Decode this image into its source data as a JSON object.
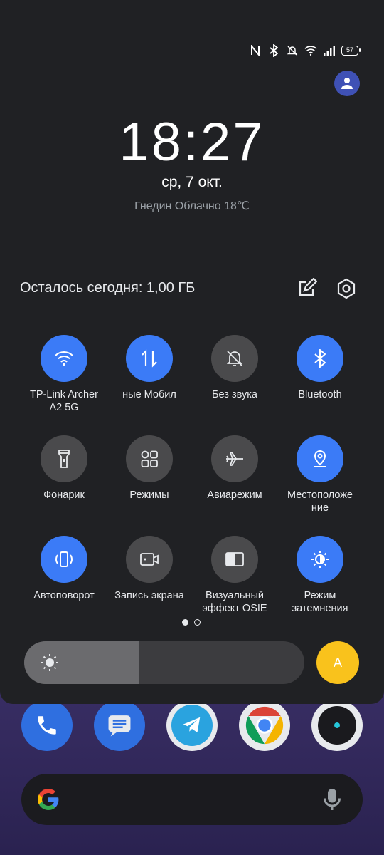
{
  "status_bar": {
    "icons": [
      "nfc-icon",
      "bluetooth-icon",
      "mute-icon",
      "wifi-icon",
      "signal-icon"
    ],
    "battery": "57"
  },
  "clock": {
    "time": "18:27",
    "date": "ср, 7 окт.",
    "weather": "Гнедин Облачно 18℃"
  },
  "data_usage": {
    "text": "Осталось сегодня: 1,00 ГБ"
  },
  "tiles": [
    {
      "label": "TP-Link Archer\nA2 5G",
      "state": "on",
      "icon": "wifi-icon"
    },
    {
      "label": "ные     Мобил",
      "state": "on",
      "icon": "mobile-data-icon"
    },
    {
      "label": "Без звука",
      "state": "off",
      "icon": "mute-icon"
    },
    {
      "label": "Bluetooth",
      "state": "on",
      "icon": "bluetooth-icon"
    },
    {
      "label": "Фонарик",
      "state": "off",
      "icon": "flashlight-icon"
    },
    {
      "label": "Режимы",
      "state": "off",
      "icon": "modes-icon"
    },
    {
      "label": "Авиарежим",
      "state": "off",
      "icon": "airplane-icon"
    },
    {
      "label": "Местоположе\nние",
      "state": "on",
      "icon": "location-icon"
    },
    {
      "label": "Автоповорот",
      "state": "on",
      "icon": "autorotate-icon"
    },
    {
      "label": "Запись экрана",
      "state": "off",
      "icon": "screen-record-icon"
    },
    {
      "label": "Визуальный\nэффект OSIE",
      "state": "off",
      "icon": "osie-icon"
    },
    {
      "label": "Режим\nзатемнения",
      "state": "on",
      "icon": "dark-mode-icon"
    }
  ],
  "pager": {
    "pages": 2,
    "current": 1
  },
  "brightness": {
    "level": 0.41,
    "auto_label": "A"
  },
  "dock": {
    "apps": [
      "phone-app-icon",
      "messages-app-icon",
      "telegram-app-icon",
      "chrome-app-icon",
      "camera-app-icon"
    ]
  },
  "colors": {
    "accent": "#3b7bf7",
    "tile_off": "#4a4a4c",
    "auto": "#f9c21c",
    "shade": "#202124"
  }
}
